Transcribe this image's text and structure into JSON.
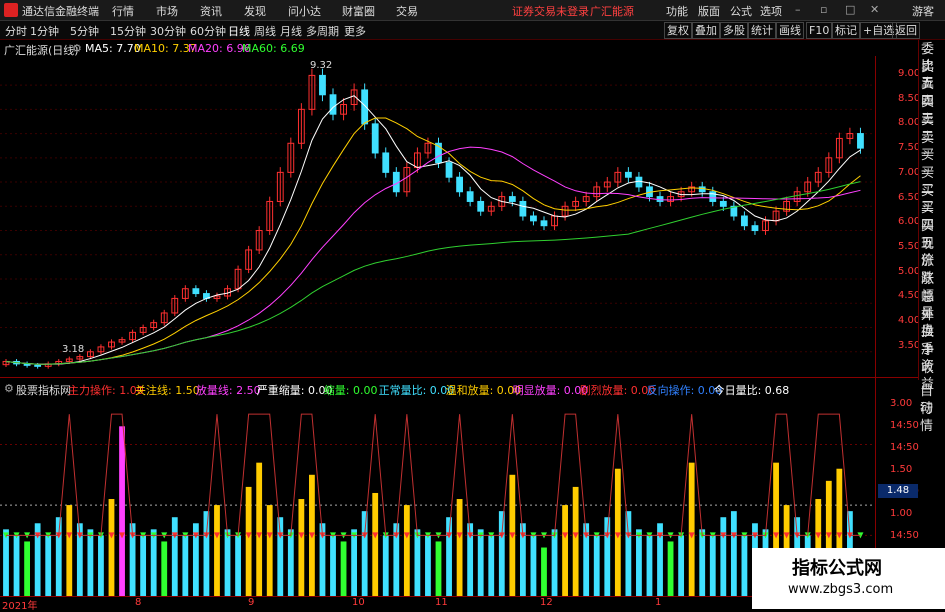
{
  "app": {
    "title": "通达信金融终端",
    "menu": [
      "行情",
      "市场",
      "资讯",
      "发现",
      "问小达",
      "财富圈",
      "交易"
    ],
    "notice": "证券交易未登录",
    "stock": "广汇能源",
    "right_menu": [
      "功能",
      "版面",
      "公式",
      "选项"
    ],
    "guest": "游客"
  },
  "toolbar": {
    "periods": [
      "分时",
      "1分钟",
      "5分钟",
      "15分钟",
      "30分钟",
      "60分钟",
      "日线",
      "周线",
      "月线",
      "多周期",
      "更多"
    ],
    "buttons": [
      "复权",
      "叠加",
      "多股",
      "统计",
      "画线",
      "F10",
      "标记",
      "+自选",
      "返回"
    ]
  },
  "main": {
    "title": "广汇能源(日线)",
    "ma5": "MA5: 7.70",
    "ma10": "MA10: 7.37",
    "ma20": "MA20: 6.96",
    "ma60": "MA60: 6.69",
    "high_label": "9.32",
    "low_label": "3.18"
  },
  "indicator": {
    "name": "股票指标网",
    "items": [
      {
        "label": "主力操作: 1.00",
        "color": "#ff3030"
      },
      {
        "label": "关注线: 1.50",
        "color": "#ffcc00"
      },
      {
        "label": "放量线: 2.50",
        "color": "#ff40ff"
      },
      {
        "label": "严重缩量: 0.00",
        "color": "#ffffff"
      },
      {
        "label": "缩量: 0.00",
        "color": "#30ff30"
      },
      {
        "label": "正常量比: 0.00",
        "color": "#40e0ff"
      },
      {
        "label": "温和放量: 0.00",
        "color": "#ffcc00"
      },
      {
        "label": "明显放量: 0.00",
        "color": "#ff40ff"
      },
      {
        "label": "剧烈放量: 0.00",
        "color": "#ff3030"
      },
      {
        "label": "反向操作: 0.00",
        "color": "#3080ff"
      },
      {
        "label": "今日量比: 0.68",
        "color": "#ffffff"
      }
    ],
    "current_value": "1.48"
  },
  "side_panel": [
    "委比",
    "卖五",
    "卖四",
    "卖三",
    "卖二",
    "卖一",
    "买一",
    "买二",
    "买三",
    "买四",
    "买五",
    "现价",
    "涨跌",
    "涨幅",
    "总量",
    "外盘",
    "换手",
    "净资",
    "收益"
  ],
  "side_panel2": [
    "自动",
    "行情"
  ],
  "y_main_ticks": [
    "9.00",
    "8.50",
    "8.00",
    "7.50",
    "7.00",
    "6.50",
    "6.00",
    "5.50",
    "5.00",
    "4.50",
    "4.00",
    "3.50"
  ],
  "y_ind_ticks": [
    "3.00",
    "14:50",
    "14:50",
    "1.50",
    "14:50",
    "1.00",
    "14:50"
  ],
  "x_ticks": [
    "2021年",
    "8",
    "9",
    "10",
    "11",
    "12",
    "1"
  ],
  "watermark": {
    "title": "指标公式网",
    "url": "www.zbgs3.com"
  },
  "chart_data": {
    "type": "candlestick",
    "y_range": [
      3.0,
      9.6
    ],
    "close_series": [
      3.3,
      3.25,
      3.22,
      3.2,
      3.25,
      3.3,
      3.35,
      3.4,
      3.5,
      3.6,
      3.7,
      3.75,
      3.9,
      4.0,
      4.1,
      4.3,
      4.6,
      4.8,
      4.7,
      4.6,
      4.65,
      4.8,
      5.2,
      5.6,
      6.0,
      6.6,
      7.2,
      7.8,
      8.5,
      9.2,
      8.8,
      8.4,
      8.6,
      8.9,
      8.2,
      7.6,
      7.2,
      6.8,
      7.3,
      7.6,
      7.8,
      7.4,
      7.1,
      6.8,
      6.6,
      6.4,
      6.5,
      6.7,
      6.6,
      6.3,
      6.2,
      6.1,
      6.3,
      6.5,
      6.6,
      6.7,
      6.9,
      7.0,
      7.2,
      7.1,
      6.9,
      6.7,
      6.6,
      6.7,
      6.8,
      6.9,
      6.8,
      6.6,
      6.5,
      6.3,
      6.1,
      6.0,
      6.2,
      6.4,
      6.6,
      6.8,
      7.0,
      7.2,
      7.5,
      7.9,
      8.0,
      7.7
    ],
    "volume_ratio": [
      1.1,
      1.0,
      0.9,
      1.2,
      1.0,
      1.3,
      1.5,
      1.2,
      1.1,
      1.0,
      1.6,
      2.8,
      1.2,
      1.0,
      1.1,
      0.9,
      1.3,
      1.0,
      1.2,
      1.4,
      1.5,
      1.1,
      1.0,
      1.8,
      2.2,
      1.5,
      1.3,
      1.1,
      1.6,
      2.0,
      1.2,
      1.0,
      0.9,
      1.1,
      1.4,
      1.7,
      1.0,
      1.2,
      1.5,
      1.1,
      1.0,
      0.9,
      1.3,
      1.6,
      1.2,
      1.1,
      1.0,
      1.4,
      2.0,
      1.2,
      1.0,
      0.8,
      1.1,
      1.5,
      1.8,
      1.2,
      1.0,
      1.3,
      2.1,
      1.4,
      1.1,
      1.0,
      1.2,
      0.9,
      1.0,
      2.2,
      1.1,
      1.0,
      1.3,
      1.4,
      1.0,
      1.2,
      1.1,
      2.2,
      1.5,
      1.3,
      1.0,
      1.6,
      1.9,
      2.1,
      1.4,
      0.68
    ]
  }
}
